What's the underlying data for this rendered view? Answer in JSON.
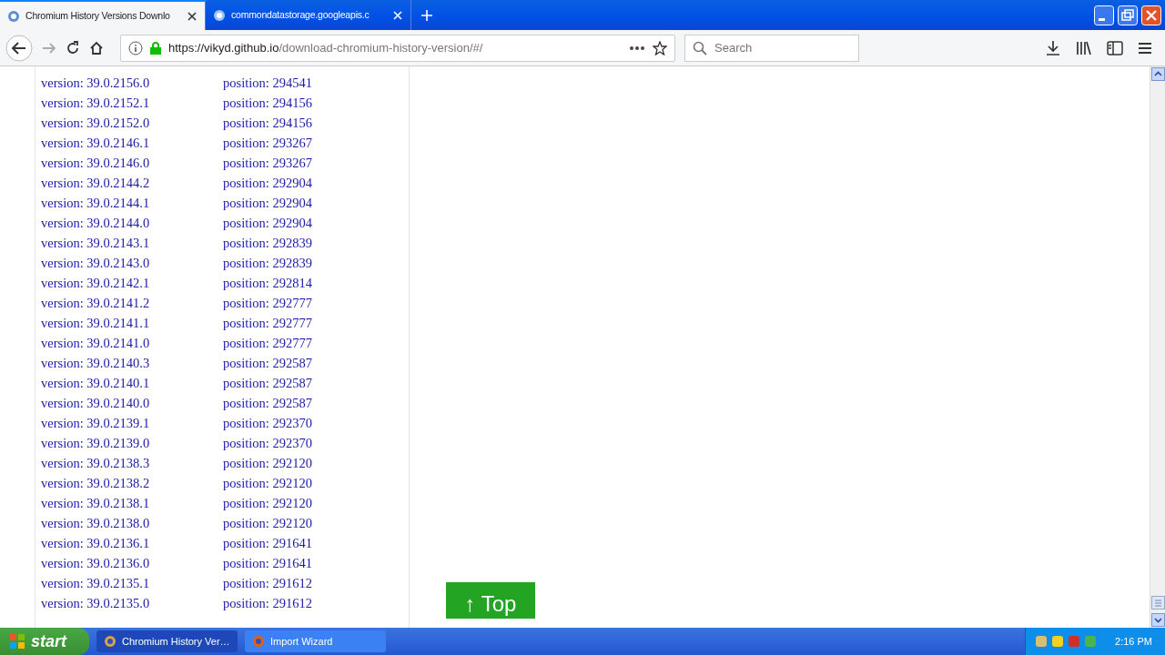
{
  "tabs": [
    {
      "label": "Chromium History Versions Downlo",
      "selected": true
    },
    {
      "label": "commondatastorage.googleapis.c",
      "selected": false
    }
  ],
  "address": {
    "host": "https://vikyd.github.io",
    "path": "/download-chromium-history-version/#/"
  },
  "search": {
    "placeholder": "Search"
  },
  "rows": [
    {
      "version": "version: 39.0.2156.0",
      "position": "position: 294541"
    },
    {
      "version": "version: 39.0.2152.1",
      "position": "position: 294156"
    },
    {
      "version": "version: 39.0.2152.0",
      "position": "position: 294156"
    },
    {
      "version": "version: 39.0.2146.1",
      "position": "position: 293267"
    },
    {
      "version": "version: 39.0.2146.0",
      "position": "position: 293267"
    },
    {
      "version": "version: 39.0.2144.2",
      "position": "position: 292904"
    },
    {
      "version": "version: 39.0.2144.1",
      "position": "position: 292904"
    },
    {
      "version": "version: 39.0.2144.0",
      "position": "position: 292904"
    },
    {
      "version": "version: 39.0.2143.1",
      "position": "position: 292839"
    },
    {
      "version": "version: 39.0.2143.0",
      "position": "position: 292839"
    },
    {
      "version": "version: 39.0.2142.1",
      "position": "position: 292814"
    },
    {
      "version": "version: 39.0.2141.2",
      "position": "position: 292777"
    },
    {
      "version": "version: 39.0.2141.1",
      "position": "position: 292777"
    },
    {
      "version": "version: 39.0.2141.0",
      "position": "position: 292777"
    },
    {
      "version": "version: 39.0.2140.3",
      "position": "position: 292587"
    },
    {
      "version": "version: 39.0.2140.1",
      "position": "position: 292587"
    },
    {
      "version": "version: 39.0.2140.0",
      "position": "position: 292587"
    },
    {
      "version": "version: 39.0.2139.1",
      "position": "position: 292370"
    },
    {
      "version": "version: 39.0.2139.0",
      "position": "position: 292370"
    },
    {
      "version": "version: 39.0.2138.3",
      "position": "position: 292120"
    },
    {
      "version": "version: 39.0.2138.2",
      "position": "position: 292120"
    },
    {
      "version": "version: 39.0.2138.1",
      "position": "position: 292120"
    },
    {
      "version": "version: 39.0.2138.0",
      "position": "position: 292120"
    },
    {
      "version": "version: 39.0.2136.1",
      "position": "position: 291641"
    },
    {
      "version": "version: 39.0.2136.0",
      "position": "position: 291641"
    },
    {
      "version": "version: 39.0.2135.1",
      "position": "position: 291612"
    },
    {
      "version": "version: 39.0.2135.0",
      "position": "position: 291612"
    }
  ],
  "top_button": {
    "label": "↑ Top"
  },
  "taskbar": {
    "start": "start",
    "tasks": [
      {
        "label": "Chromium History Ver…",
        "selected": true
      },
      {
        "label": "Import Wizard",
        "selected": false
      }
    ],
    "clock": "2:16 PM"
  }
}
